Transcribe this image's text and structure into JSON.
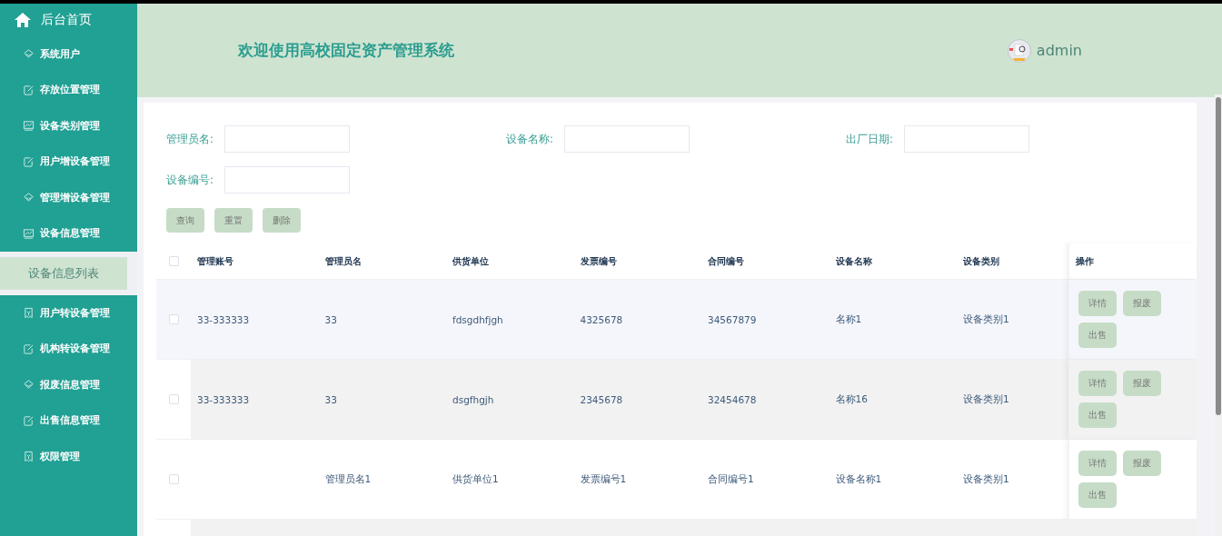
{
  "sidebar": {
    "home": {
      "label": "后台首页"
    },
    "items": [
      {
        "label": "系统用户",
        "selected": false
      },
      {
        "label": "存放位置管理",
        "selected": false
      },
      {
        "label": "设备类别管理",
        "selected": false
      },
      {
        "label": "用户增设备管理",
        "selected": false
      },
      {
        "label": "管理增设备管理",
        "selected": false
      },
      {
        "label": "设备信息管理",
        "selected": false
      },
      {
        "label": "设备信息列表",
        "selected": true
      },
      {
        "label": "用户转设备管理",
        "selected": false
      },
      {
        "label": "机构转设备管理",
        "selected": false
      },
      {
        "label": "报废信息管理",
        "selected": false
      },
      {
        "label": "出售信息管理",
        "selected": false
      },
      {
        "label": "权限管理",
        "selected": false
      }
    ]
  },
  "header": {
    "title": "欢迎使用高校固定资产管理系统",
    "user": "admin"
  },
  "search": {
    "fields": [
      {
        "label": "管理员名:"
      },
      {
        "label": "设备名称:"
      },
      {
        "label": "出厂日期:"
      },
      {
        "label": "设备编号:"
      }
    ],
    "buttons": [
      "查询",
      "重置",
      "删除"
    ]
  },
  "table": {
    "select_all": {
      "checked": false
    },
    "columns": [
      "管理账号",
      "管理员名",
      "供货单位",
      "发票编号",
      "合同编号",
      "设备名称",
      "设备类别",
      "操作"
    ],
    "rows": [
      {
        "checked": false,
        "cells": [
          "33-333333",
          "33",
          "fdsgdhfjgh",
          "4325678",
          "34567879",
          "名称1",
          "设备类别1"
        ],
        "actions": [
          "详情",
          "报废",
          "出售"
        ]
      },
      {
        "checked": false,
        "cells": [
          "33-333333",
          "33",
          "dsgfhgjh",
          "2345678",
          "32454678",
          "名称16",
          "设备类别1"
        ],
        "actions": [
          "详情",
          "报废",
          "出售"
        ]
      },
      {
        "checked": false,
        "cells": [
          "",
          "管理员名1",
          "供货单位1",
          "发票编号1",
          "合同编号1",
          "设备名称1",
          "设备类别1"
        ],
        "actions": [
          "详情",
          "报废",
          "出售"
        ]
      }
    ]
  }
}
